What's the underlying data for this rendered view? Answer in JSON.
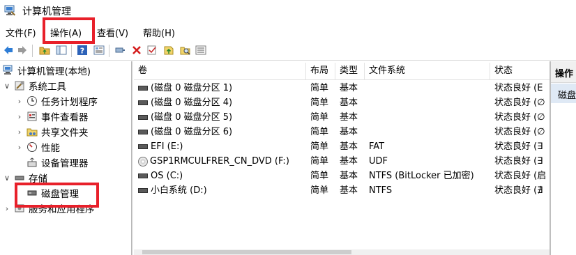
{
  "window": {
    "title": "计算机管理"
  },
  "menu": [
    "文件(F)",
    "操作(A)",
    "查看(V)",
    "帮助(H)"
  ],
  "tree": {
    "root": "计算机管理(本地)",
    "system_tools": "系统工具",
    "task_scheduler": "任务计划程序",
    "event_viewer": "事件查看器",
    "shared_folders": "共享文件夹",
    "performance": "性能",
    "device_manager": "设备管理器",
    "storage": "存储",
    "disk_management": "磁盘管理",
    "services_apps": "服务和应用程序"
  },
  "table": {
    "columns": [
      "卷",
      "布局",
      "类型",
      "文件系统",
      "状态"
    ],
    "rows": [
      {
        "volume": "(磁盘 0 磁盘分区 1)",
        "layout": "简单",
        "type": "基本",
        "fs": "",
        "status": "状态良好 (E"
      },
      {
        "volume": "(磁盘 0 磁盘分区 4)",
        "layout": "简单",
        "type": "基本",
        "fs": "",
        "status": "状态良好 (∅"
      },
      {
        "volume": "(磁盘 0 磁盘分区 5)",
        "layout": "简单",
        "type": "基本",
        "fs": "",
        "status": "状态良好 (∅"
      },
      {
        "volume": "(磁盘 0 磁盘分区 6)",
        "layout": "简单",
        "type": "基本",
        "fs": "",
        "status": "状态良好 (∅"
      },
      {
        "volume": "EFI (E:)",
        "layout": "简单",
        "type": "基本",
        "fs": "FAT",
        "status": "状态良好 (∃"
      },
      {
        "volume": "GSP1RMCULFRER_CN_DVD (F:)",
        "layout": "简单",
        "type": "基本",
        "fs": "UDF",
        "status": "状态良好 (∃"
      },
      {
        "volume": "OS (C:)",
        "layout": "简单",
        "type": "基本",
        "fs": "NTFS (BitLocker 已加密)",
        "status": "状态良好 (启"
      },
      {
        "volume": "小白系统 (D:)",
        "layout": "简单",
        "type": "基本",
        "fs": "NTFS",
        "status": "状态良好 (∄"
      }
    ]
  },
  "actions": {
    "title": "操作",
    "item": "磁盘"
  },
  "colors": {
    "highlight_box": "#e8202a",
    "selected_bg": "#dfe9f5"
  }
}
